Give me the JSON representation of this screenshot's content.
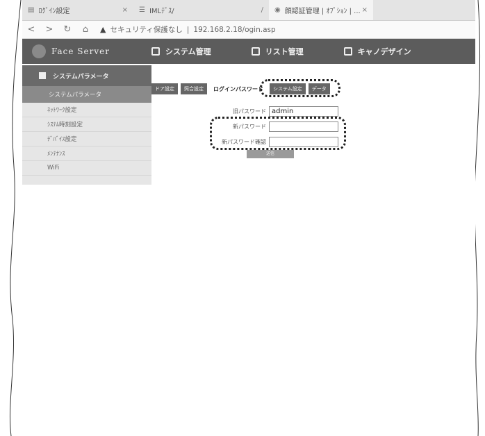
{
  "browser": {
    "tabs": [
      {
        "label": "ﾛｸﾞｲﾝ設定",
        "close": "×"
      },
      {
        "label": "IMLﾃﾞｽ/",
        "close": "/"
      },
      {
        "label": "顔認証管理 | ｵﾌﾟｼｮﾝ | ...",
        "close": "×"
      }
    ],
    "nav": {
      "back": "<",
      "forward": ">",
      "reload": "↻",
      "home": "⌂"
    },
    "security_warning": "セキュリティ保護なし",
    "url": "192.168.2.18/ogin.asp"
  },
  "app": {
    "brand": "Face Server",
    "main_nav": [
      "システム管理",
      "リスト管理",
      "キャノデザイン"
    ],
    "sidebar": {
      "header": "システムパラメータ",
      "active_item": "システムパラメータ",
      "items": [
        "ﾈｯﾄﾜｰｸ設定",
        "ｼｽﾃﾑ時刻設定",
        "ﾃﾞﾊﾞｲｽ設定",
        "ﾒﾝﾃﾅﾝｽ",
        "WiFi"
      ]
    },
    "subtabs": [
      "ドア設定",
      "照合設定",
      "ログインパスワード",
      "システム設定",
      "データ"
    ],
    "active_subtab": "ログインパスワード",
    "form": {
      "fields": [
        {
          "label": "旧パスワード",
          "value": "admin"
        },
        {
          "label": "新パスワード",
          "value": ""
        },
        {
          "label": "新パスワード確認",
          "value": ""
        }
      ],
      "submit": "送信"
    }
  }
}
